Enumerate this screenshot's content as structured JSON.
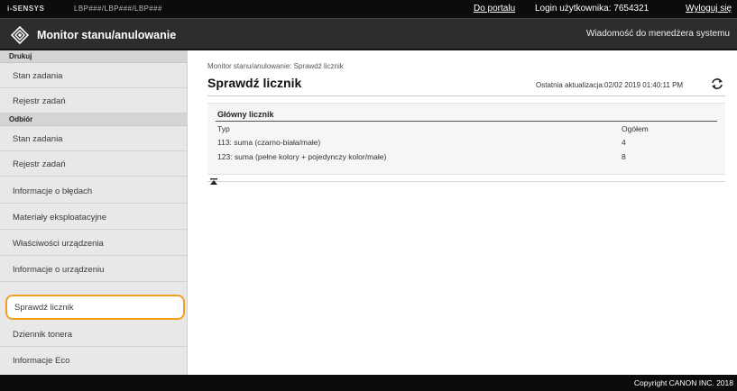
{
  "topbar": {
    "brand": "i-SENSYS",
    "device": "LBP###/LBP###/LBP###",
    "portal_link": "Do portalu",
    "login_text": "Login użytkownika:  7654321",
    "logout_link": "Wyloguj się"
  },
  "header": {
    "app_title": "Monitor stanu/anulowanie",
    "message_link": "Wiadomość do menedżera systemu"
  },
  "sidebar": {
    "sections": [
      {
        "heading": "Drukuj",
        "items": [
          {
            "label": "Stan zadania"
          },
          {
            "label": "Rejestr zadań"
          }
        ]
      },
      {
        "heading": "Odbiór",
        "items": [
          {
            "label": "Stan zadania"
          },
          {
            "label": "Rejestr zadań"
          }
        ]
      }
    ],
    "items": [
      {
        "label": "Informacje o błędach"
      },
      {
        "label": "Materiały eksploatacyjne"
      },
      {
        "label": "Właściwości urządzenia"
      },
      {
        "label": "Informacje o urządzeniu"
      },
      {
        "label": "Sprawdź licznik",
        "active": true
      },
      {
        "label": "Dziennik tonera"
      },
      {
        "label": "Informacje Eco"
      }
    ]
  },
  "main": {
    "breadcrumb": "Monitor stanu/anulowanie: Sprawdź licznik",
    "title": "Sprawdź licznik",
    "last_updated": "Ostatnia aktualizacja:02/02 2019 01:40:11 PM",
    "panel": {
      "title": "Główny licznik",
      "columns": [
        "Typ",
        "Ogółem"
      ],
      "rows": [
        {
          "type": "113: suma (czarno-biała/małe)",
          "total": "4"
        },
        {
          "type": "123: suma (pełne kolory + pojedynczy kolor/małe)",
          "total": "8"
        }
      ]
    }
  },
  "footer": {
    "copyright": "Copyright CANON INC. 2018"
  },
  "icons": {
    "app": "monitor-diamond-icon",
    "refresh": "refresh-icon",
    "back_to_top": "back-to-top-icon"
  }
}
